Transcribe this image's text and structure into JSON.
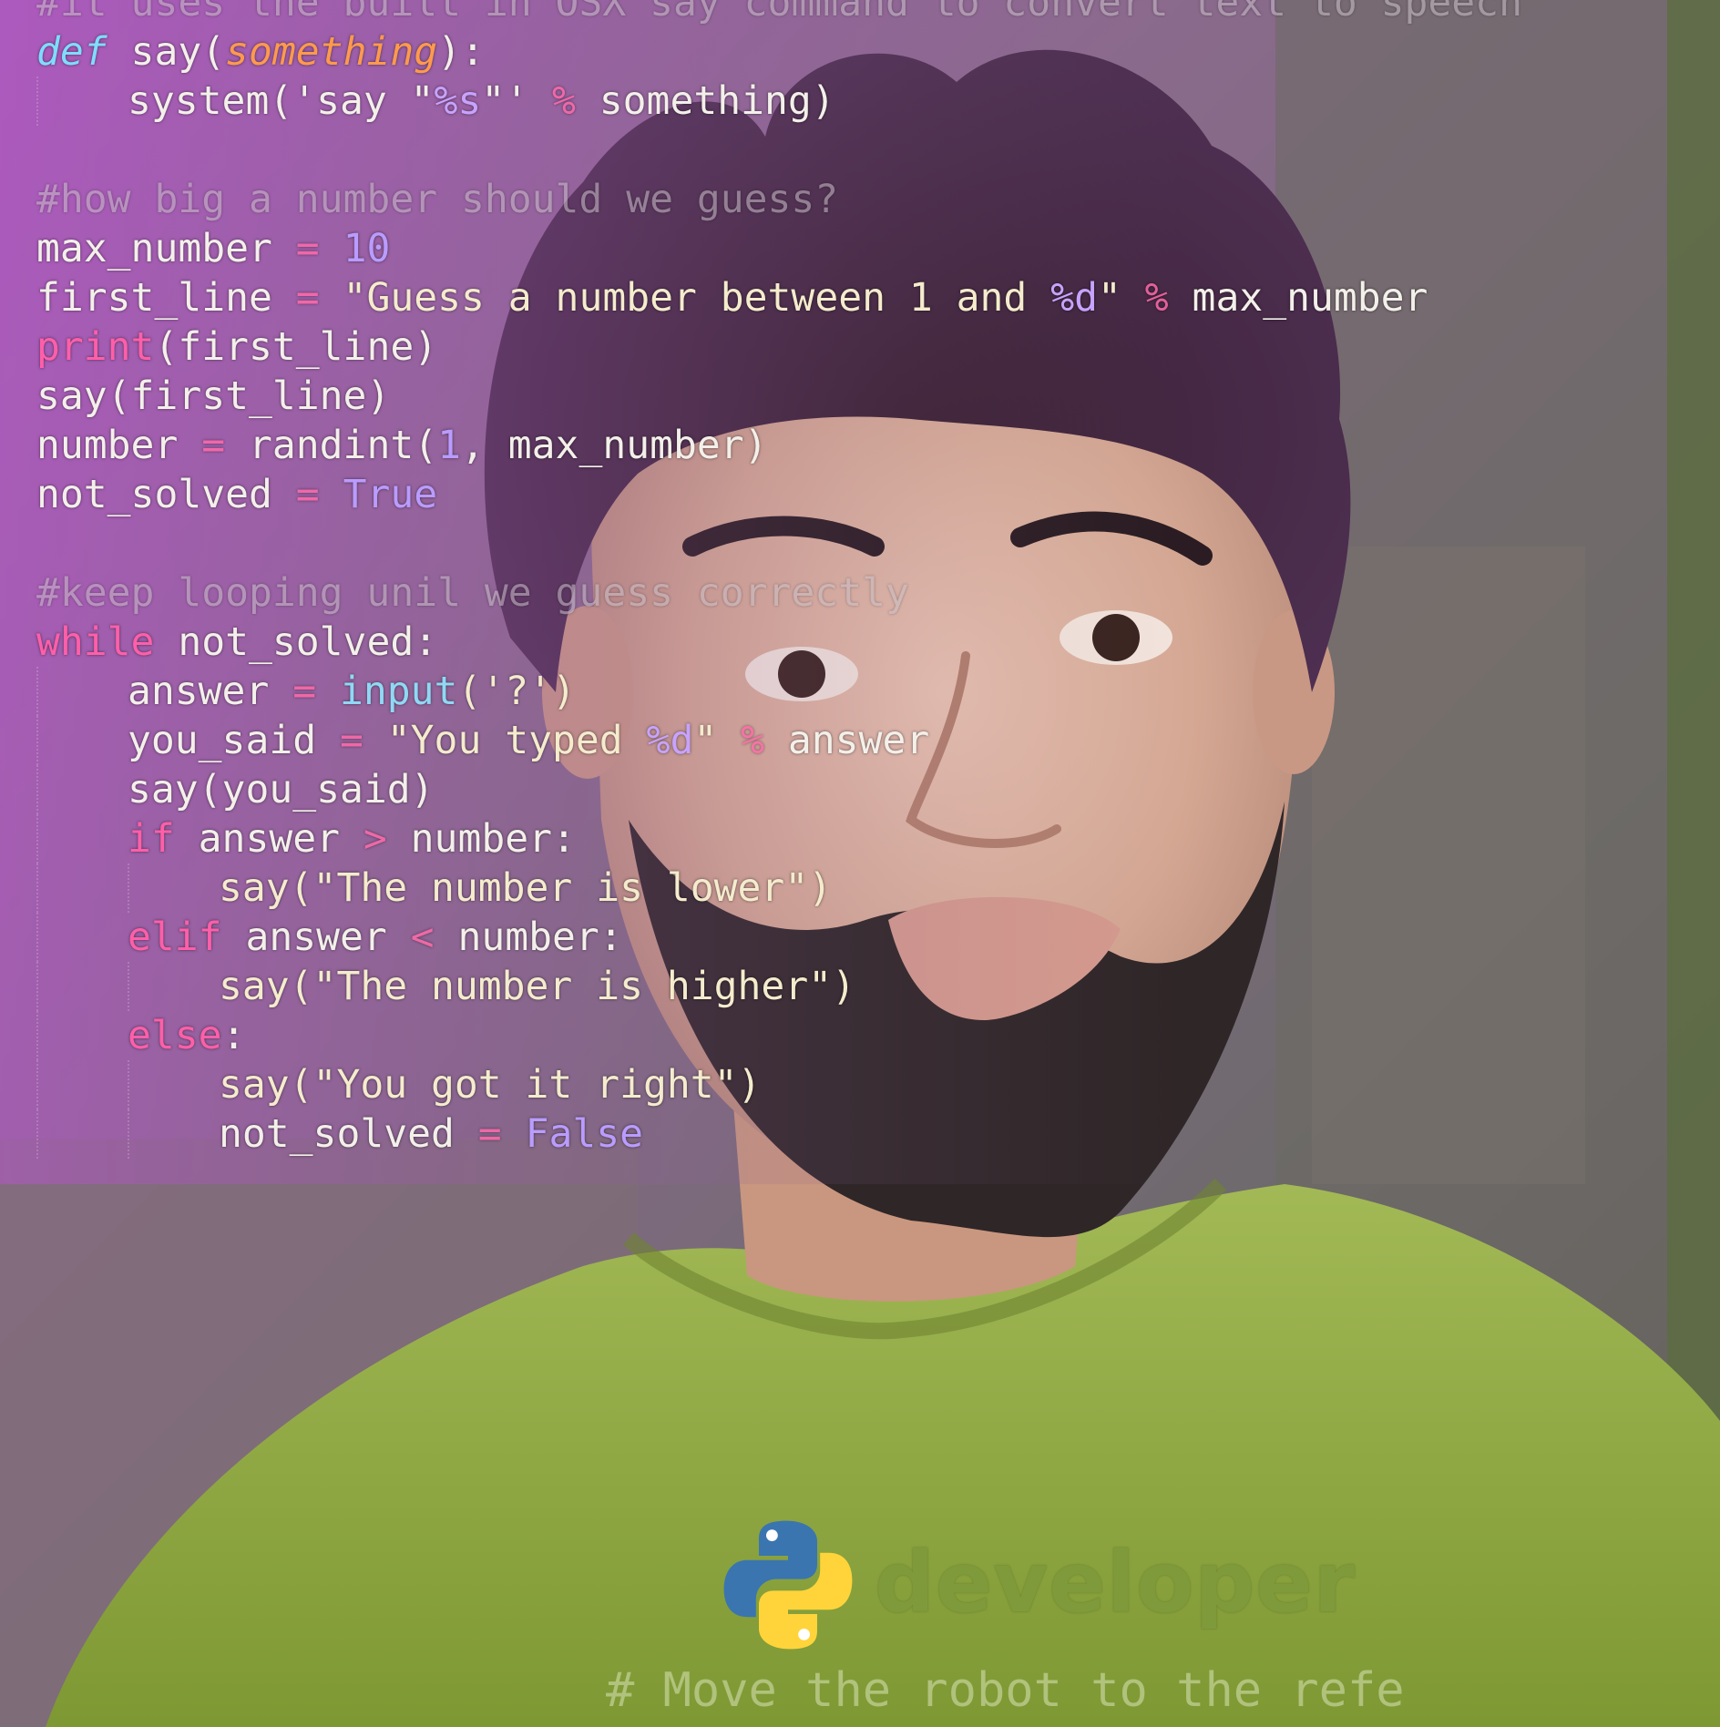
{
  "image": {
    "alt": "Portrait photo of a man with dark spiky hair and a beard wearing a green t-shirt, overlaid with syntax-highlighted Python code",
    "subject_shirt_color": "#8da63f",
    "background_tint": "#a45fb2"
  },
  "code_overlay": {
    "colors": {
      "keyword": "#ff5fa8",
      "def_keyword": "#7fdcff",
      "number": "#b99cff",
      "string": "#f4eccd",
      "parameter": "#ff9a4c",
      "comment": "#c9bfc8",
      "plain": "#f3f0ea"
    },
    "lines": [
      {
        "indent": 0,
        "tokens": [
          {
            "t": "#it uses the built in OSX say command to convert text to speech",
            "c": "cm"
          }
        ]
      },
      {
        "indent": 0,
        "tokens": [
          {
            "t": "def",
            "c": "def"
          },
          {
            "t": " say(",
            "c": "pl"
          },
          {
            "t": "something",
            "c": "param"
          },
          {
            "t": "):",
            "c": "pl"
          }
        ]
      },
      {
        "indent": 1,
        "tokens": [
          {
            "t": "system('say \"",
            "c": "pl"
          },
          {
            "t": "%s",
            "c": "fmt"
          },
          {
            "t": "\"' ",
            "c": "pl"
          },
          {
            "t": "%",
            "c": "op"
          },
          {
            "t": " something)",
            "c": "pl"
          }
        ]
      },
      {
        "indent": 0,
        "tokens": []
      },
      {
        "indent": 0,
        "tokens": [
          {
            "t": "#how big a number should we guess?",
            "c": "cm"
          }
        ]
      },
      {
        "indent": 0,
        "tokens": [
          {
            "t": "max_number ",
            "c": "pl"
          },
          {
            "t": "=",
            "c": "op"
          },
          {
            "t": " ",
            "c": "pl"
          },
          {
            "t": "10",
            "c": "num"
          }
        ]
      },
      {
        "indent": 0,
        "tokens": [
          {
            "t": "first_line ",
            "c": "pl"
          },
          {
            "t": "=",
            "c": "op"
          },
          {
            "t": " \"Guess a number between 1 and ",
            "c": "str"
          },
          {
            "t": "%d",
            "c": "fmt"
          },
          {
            "t": "\" ",
            "c": "str"
          },
          {
            "t": "%",
            "c": "op"
          },
          {
            "t": " max_number",
            "c": "pl"
          }
        ]
      },
      {
        "indent": 0,
        "tokens": [
          {
            "t": "print",
            "c": "kw"
          },
          {
            "t": "(first_line)",
            "c": "pl"
          }
        ]
      },
      {
        "indent": 0,
        "tokens": [
          {
            "t": "say(first_line)",
            "c": "pl"
          }
        ]
      },
      {
        "indent": 0,
        "tokens": [
          {
            "t": "number ",
            "c": "pl"
          },
          {
            "t": "=",
            "c": "op"
          },
          {
            "t": " randint(",
            "c": "pl"
          },
          {
            "t": "1",
            "c": "num"
          },
          {
            "t": ", max_number)",
            "c": "pl"
          }
        ]
      },
      {
        "indent": 0,
        "tokens": [
          {
            "t": "not_solved ",
            "c": "pl"
          },
          {
            "t": "=",
            "c": "op"
          },
          {
            "t": " ",
            "c": "pl"
          },
          {
            "t": "True",
            "c": "num"
          }
        ]
      },
      {
        "indent": 0,
        "tokens": []
      },
      {
        "indent": 0,
        "tokens": [
          {
            "t": "#keep looping unil we guess correctly",
            "c": "cm"
          }
        ]
      },
      {
        "indent": 0,
        "tokens": [
          {
            "t": "while",
            "c": "kw"
          },
          {
            "t": " not_solved:",
            "c": "pl"
          }
        ]
      },
      {
        "indent": 1,
        "tokens": [
          {
            "t": "answer ",
            "c": "pl"
          },
          {
            "t": "=",
            "c": "op"
          },
          {
            "t": " ",
            "c": "pl"
          },
          {
            "t": "input",
            "c": "bi"
          },
          {
            "t": "('?')",
            "c": "str"
          }
        ]
      },
      {
        "indent": 1,
        "tokens": [
          {
            "t": "you_said ",
            "c": "pl"
          },
          {
            "t": "=",
            "c": "op"
          },
          {
            "t": " \"You typed ",
            "c": "str"
          },
          {
            "t": "%d",
            "c": "fmt"
          },
          {
            "t": "\" ",
            "c": "str"
          },
          {
            "t": "%",
            "c": "op"
          },
          {
            "t": " answer",
            "c": "pl"
          }
        ]
      },
      {
        "indent": 1,
        "tokens": [
          {
            "t": "say(you_said)",
            "c": "pl"
          }
        ]
      },
      {
        "indent": 1,
        "tokens": [
          {
            "t": "if",
            "c": "kw"
          },
          {
            "t": " answer ",
            "c": "pl"
          },
          {
            "t": ">",
            "c": "op"
          },
          {
            "t": " number:",
            "c": "pl"
          }
        ]
      },
      {
        "indent": 2,
        "tokens": [
          {
            "t": "say(\"The number is lower\")",
            "c": "str"
          }
        ]
      },
      {
        "indent": 1,
        "tokens": [
          {
            "t": "elif",
            "c": "kw"
          },
          {
            "t": " answer ",
            "c": "pl"
          },
          {
            "t": "<",
            "c": "op"
          },
          {
            "t": " number:",
            "c": "pl"
          }
        ]
      },
      {
        "indent": 2,
        "tokens": [
          {
            "t": "say(\"The number is higher\")",
            "c": "str"
          }
        ]
      },
      {
        "indent": 1,
        "tokens": [
          {
            "t": "else",
            "c": "kw"
          },
          {
            "t": ":",
            "c": "pl"
          }
        ]
      },
      {
        "indent": 2,
        "tokens": [
          {
            "t": "say(\"You got it right\")",
            "c": "str"
          }
        ]
      },
      {
        "indent": 2,
        "tokens": [
          {
            "t": "not_solved ",
            "c": "pl"
          },
          {
            "t": "=",
            "c": "op"
          },
          {
            "t": " ",
            "c": "pl"
          },
          {
            "t": "False",
            "c": "num"
          }
        ]
      }
    ]
  },
  "branding": {
    "logo_icon": "python-logo-icon",
    "logo_colors": {
      "blue": "#3a75b0",
      "yellow": "#ffd43b"
    },
    "text": "developer",
    "text_color": "#7f9a3a"
  },
  "bottom_comment": "# Move the robot to the refe"
}
